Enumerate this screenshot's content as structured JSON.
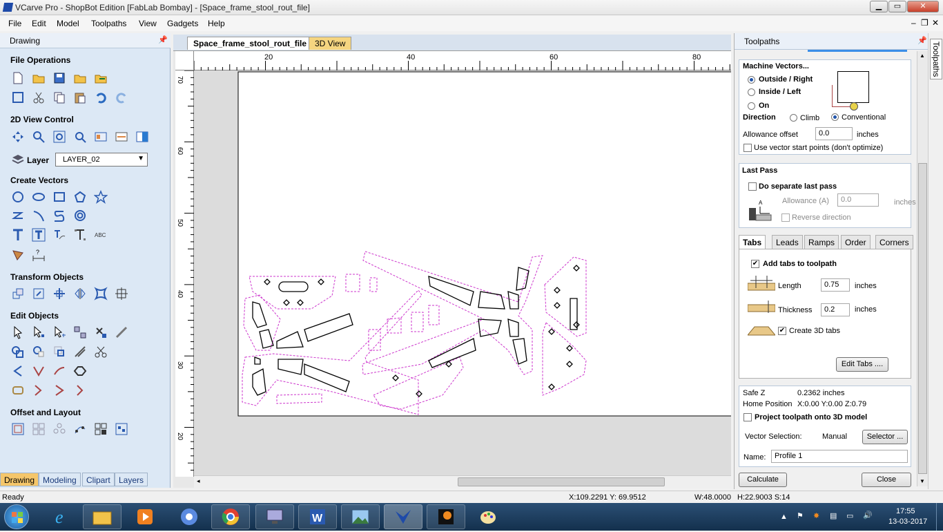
{
  "window": {
    "title": "VCarve Pro - ShopBot Edition [FabLab Bombay] - [Space_frame_stool_rout_file]"
  },
  "menu": [
    "File",
    "Edit",
    "Model",
    "Toolpaths",
    "View",
    "Gadgets",
    "Help"
  ],
  "left_panel": {
    "title": "Drawing",
    "sections": {
      "file_ops": "File Operations",
      "view_2d": "2D View Control",
      "create_vectors": "Create Vectors",
      "transform": "Transform Objects",
      "edit": "Edit Objects",
      "offset": "Offset and Layout"
    },
    "layer_label": "Layer",
    "layer_value": "LAYER_02",
    "bottom_tabs": [
      "Drawing",
      "Modeling",
      "Clipart",
      "Layers"
    ]
  },
  "document": {
    "tabs": [
      "Space_frame_stool_rout_file",
      "3D View"
    ],
    "ruler_h": [
      "20",
      "40",
      "60",
      "80"
    ],
    "ruler_v": [
      "70",
      "60",
      "50",
      "40",
      "30",
      "20"
    ]
  },
  "right_panel": {
    "title": "Toolpaths",
    "side_tab": "Toolpaths",
    "machine_vectors": {
      "heading": "Machine Vectors...",
      "outside": "Outside / Right",
      "inside": "Inside / Left",
      "on": "On",
      "direction_label": "Direction",
      "climb": "Climb",
      "conventional": "Conventional",
      "allowance_label": "Allowance offset",
      "allowance_value": "0.0",
      "units": "inches",
      "use_start_points": "Use vector start points (don't optimize)"
    },
    "last_pass": {
      "heading": "Last Pass",
      "separate": "Do separate last pass",
      "allowance_label": "Allowance (A)",
      "allowance_value": "0.0",
      "units": "inches",
      "reverse": "Reverse direction"
    },
    "tabs": [
      "Tabs",
      "Leads",
      "Ramps",
      "Order",
      "Corners"
    ],
    "tabs_panel": {
      "add_tabs": "Add tabs to toolpath",
      "length_label": "Length",
      "length_value": "0.75",
      "thickness_label": "Thickness",
      "thickness_value": "0.2",
      "units": "inches",
      "create_3d": "Create 3D tabs",
      "edit_tabs": "Edit Tabs ...."
    },
    "info": {
      "safe_z_label": "Safe Z",
      "safe_z_value": "0.2362 inches",
      "home_label": "Home Position",
      "home_value": "X:0.00 Y:0.00 Z:0.79",
      "project": "Project toolpath onto 3D model",
      "vector_sel_label": "Vector Selection:",
      "vector_sel_value": "Manual",
      "selector_button": "Selector ...",
      "name_label": "Name:",
      "name_value": "Profile 1"
    },
    "calculate": "Calculate",
    "close": "Close"
  },
  "status": {
    "ready": "Ready",
    "coords": "X:109.2291 Y: 69.9512",
    "width": "W:48.0000",
    "height_sel": "H:22.9003  S:14"
  },
  "taskbar": {
    "time": "17:55",
    "date": "13-03-2017"
  },
  "colors": {
    "toolpath": "#cc33cc",
    "accent": "#1e4aa8"
  }
}
